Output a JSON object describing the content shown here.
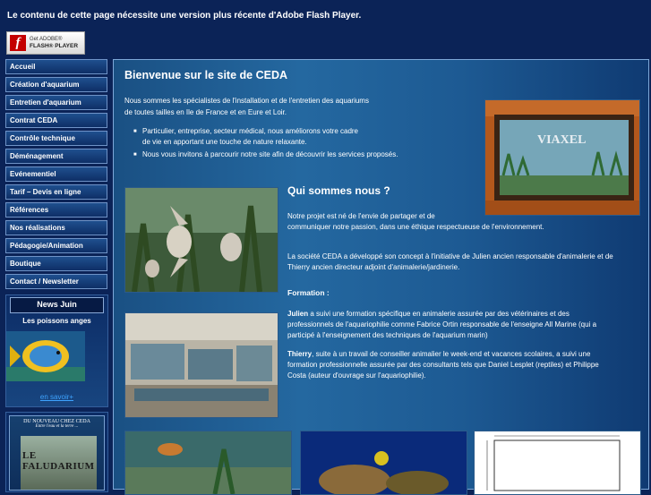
{
  "flash": {
    "message": "Le contenu de cette page nécessite une version plus récente d'Adobe Flash Player.",
    "badge_get": "Get ADOBE®",
    "badge_product": "FLASH® PLAYER"
  },
  "nav": {
    "items": [
      {
        "label": "Accueil"
      },
      {
        "label": "Création d'aquarium"
      },
      {
        "label": "Entretien d'aquarium"
      },
      {
        "label": "Contrat CEDA"
      },
      {
        "label": "Contrôle technique"
      },
      {
        "label": "Déménagement"
      },
      {
        "label": "Evénementiel"
      },
      {
        "label": "Tarif – Devis en ligne"
      },
      {
        "label": "Références"
      },
      {
        "label": "Nos réalisations"
      },
      {
        "label": "Pédagogie/Animation"
      },
      {
        "label": "Boutique"
      },
      {
        "label": "Contact / Newsletter"
      }
    ]
  },
  "news": {
    "title": "News Juin",
    "subtitle": "Les poissons anges",
    "link": "en savoir+"
  },
  "promo": {
    "title": "DU NOUVEAU CHEZ CEDA",
    "subtitle": "Entre l'eau et la terre ...",
    "word": "LE FALUDARIUM"
  },
  "main": {
    "title": "Bienvenue sur le site de CEDA",
    "intro1": "Nous sommes les spécialistes de l'installation et de l'entretien des aquariums",
    "intro2": "de toutes tailles en Ile de France et en Eure et Loir.",
    "bullet1_line1": "Particulier, entreprise, secteur médical, nous améliorons votre cadre",
    "bullet1_line2": "de vie en apportant une touche de nature relaxante.",
    "bullet2": "Nous vous invitons à parcourir notre site afin de découvrir les services proposés.",
    "who_title": "Qui sommes nous ?",
    "project1": "Notre projet est né de l'envie de partager et de",
    "project2": "communiquer notre passion, dans une éthique respectueuse de l'environnement.",
    "society1": "La société CEDA a développé son concept à l'initiative de Julien ancien responsable d'animalerie et de",
    "society2": "Thierry ancien directeur adjoint d'animalerie/jardinerie.",
    "formation_label": "Formation :",
    "julien_name": "Julien",
    "julien1": " a suivi une formation spécifique en animalerie assurée par des vétérinaires et des",
    "julien2": "professionnels de l'aquariophilie  comme Fabrice Ortin responsable de l'enseigne All Marine (qui a",
    "julien3": "participé à l'enseignement des techniques de l'aquarium marin)",
    "thierry_name": "Thierry",
    "thierry1": ", suite à un travail de conseiller animalier le week-end et vacances scolaires, a suivi une",
    "thierry2": "formation professionnelle assurée par des consultants tels que  Daniel Lesplet (reptiles) et Philippe",
    "thierry3": "Costa (auteur d'ouvrage sur l'aquariophilie).",
    "sign_text": "VIAXEL"
  }
}
